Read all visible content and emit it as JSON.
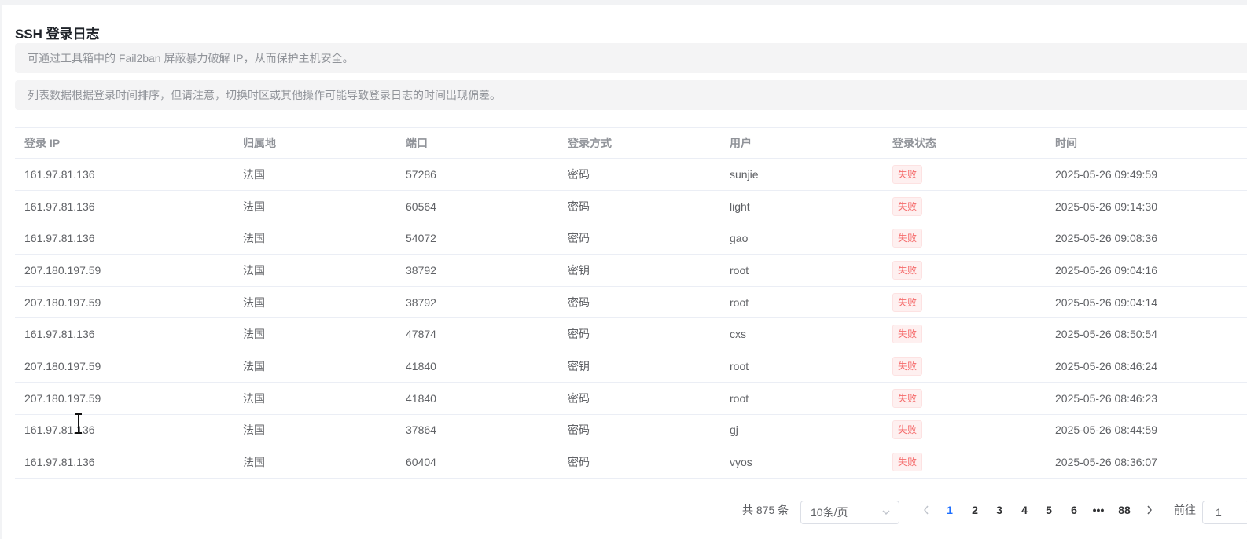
{
  "page": {
    "title": "SSH 登录日志",
    "notices": [
      "可通过工具箱中的 Fail2ban 屏蔽暴力破解 IP，从而保护主机安全。",
      "列表数据根据登录时间排序，但请注意，切换时区或其他操作可能导致登录日志的时间出现偏差。"
    ]
  },
  "table": {
    "columns": [
      "登录 IP",
      "归属地",
      "端口",
      "登录方式",
      "用户",
      "登录状态",
      "时间"
    ],
    "rows": [
      [
        "161.97.81.136",
        "法国",
        "57286",
        "密码",
        "sunjie",
        "失败",
        "2025-05-26 09:49:59"
      ],
      [
        "161.97.81.136",
        "法国",
        "60564",
        "密码",
        "light",
        "失败",
        "2025-05-26 09:14:30"
      ],
      [
        "161.97.81.136",
        "法国",
        "54072",
        "密码",
        "gao",
        "失败",
        "2025-05-26 09:08:36"
      ],
      [
        "207.180.197.59",
        "法国",
        "38792",
        "密钥",
        "root",
        "失败",
        "2025-05-26 09:04:16"
      ],
      [
        "207.180.197.59",
        "法国",
        "38792",
        "密码",
        "root",
        "失败",
        "2025-05-26 09:04:14"
      ],
      [
        "161.97.81.136",
        "法国",
        "47874",
        "密码",
        "cxs",
        "失败",
        "2025-05-26 08:50:54"
      ],
      [
        "207.180.197.59",
        "法国",
        "41840",
        "密钥",
        "root",
        "失败",
        "2025-05-26 08:46:24"
      ],
      [
        "207.180.197.59",
        "法国",
        "41840",
        "密码",
        "root",
        "失败",
        "2025-05-26 08:46:23"
      ],
      [
        "161.97.81.136",
        "法国",
        "37864",
        "密码",
        "gj",
        "失败",
        "2025-05-26 08:44:59"
      ],
      [
        "161.97.81.136",
        "法国",
        "60404",
        "密码",
        "vyos",
        "失败",
        "2025-05-26 08:36:07"
      ]
    ]
  },
  "pagination": {
    "total": "共 875 条",
    "page_size": "10条/页",
    "pages": [
      "1",
      "2",
      "3",
      "4",
      "5",
      "6",
      "•••",
      "88"
    ],
    "active_page": "1",
    "goto_label": "前往",
    "goto_value": "1"
  },
  "colors": {
    "accent": "#1e6fff",
    "fail": "#f56c6c"
  },
  "icons": {
    "prev": "chevron-left-icon",
    "next": "chevron-right-icon",
    "dropdown": "chevron-down-icon"
  }
}
